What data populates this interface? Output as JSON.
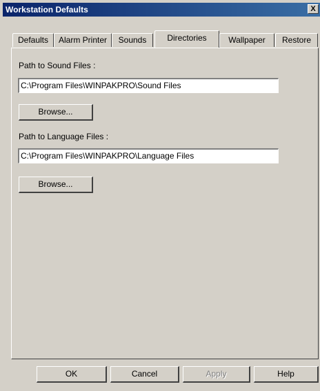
{
  "window": {
    "title": "Workstation Defaults",
    "close_label": "X"
  },
  "tabs": [
    {
      "label": "Defaults"
    },
    {
      "label": "Alarm Printer"
    },
    {
      "label": "Sounds"
    },
    {
      "label": "Directories"
    },
    {
      "label": "Wallpaper"
    },
    {
      "label": "Restore"
    }
  ],
  "active_tab": "Directories",
  "directories": {
    "sound_label": "Path to Sound Files :",
    "sound_value": "C:\\Program Files\\WINPAKPRO\\Sound Files",
    "sound_browse": "Browse...",
    "language_label": "Path to Language Files :",
    "language_value": "C:\\Program Files\\WINPAKPRO\\Language Files",
    "language_browse": "Browse..."
  },
  "footer": {
    "ok": "OK",
    "cancel": "Cancel",
    "apply": "Apply",
    "help": "Help"
  }
}
